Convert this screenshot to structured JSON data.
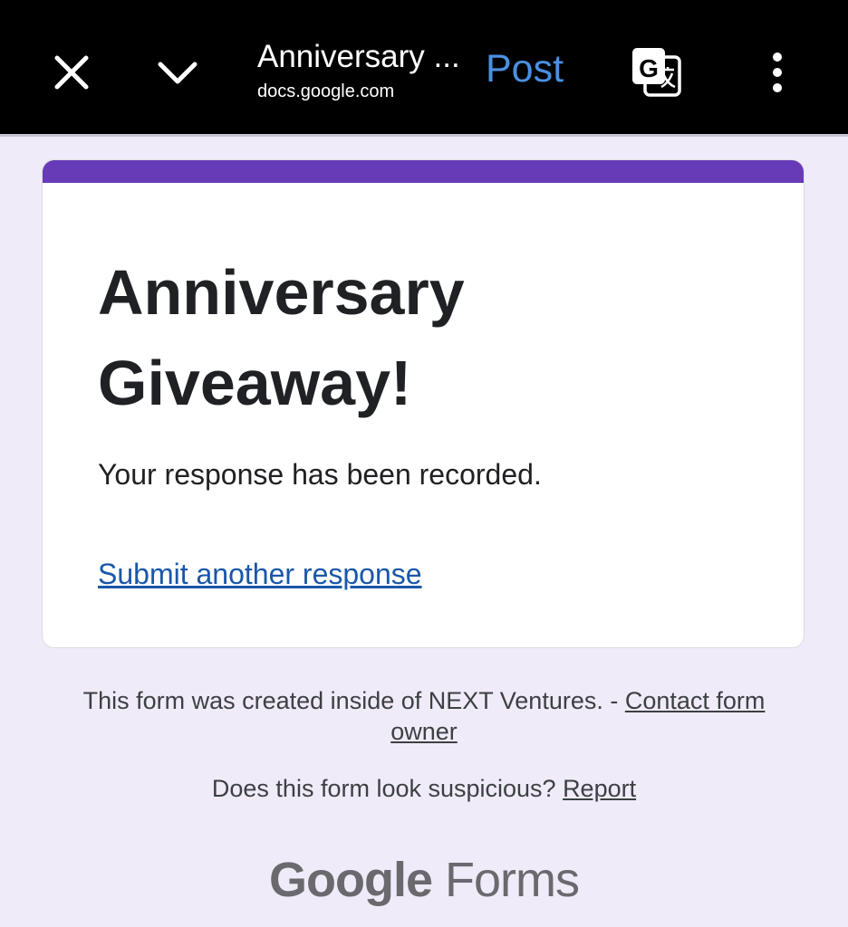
{
  "browser": {
    "title": "Anniversary ...",
    "domain": "docs.google.com",
    "post_label": "Post",
    "icons": [
      "close-icon",
      "chevron-down-icon",
      "translate-icon",
      "more-vert-icon"
    ],
    "post_color": "#4a90e2"
  },
  "form": {
    "title": "Anniversary Giveaway!",
    "confirmation": "Your response has been recorded.",
    "submit_another": "Submit another response",
    "accent_color": "#673ab7"
  },
  "footer": {
    "created_text": "This form was created inside of NEXT Ventures. - ",
    "contact_link": "Contact form owner",
    "suspicious_text": "Does this form look suspicious? ",
    "report_link": "Report",
    "brand_google": "Google",
    "brand_forms": "Forms"
  }
}
